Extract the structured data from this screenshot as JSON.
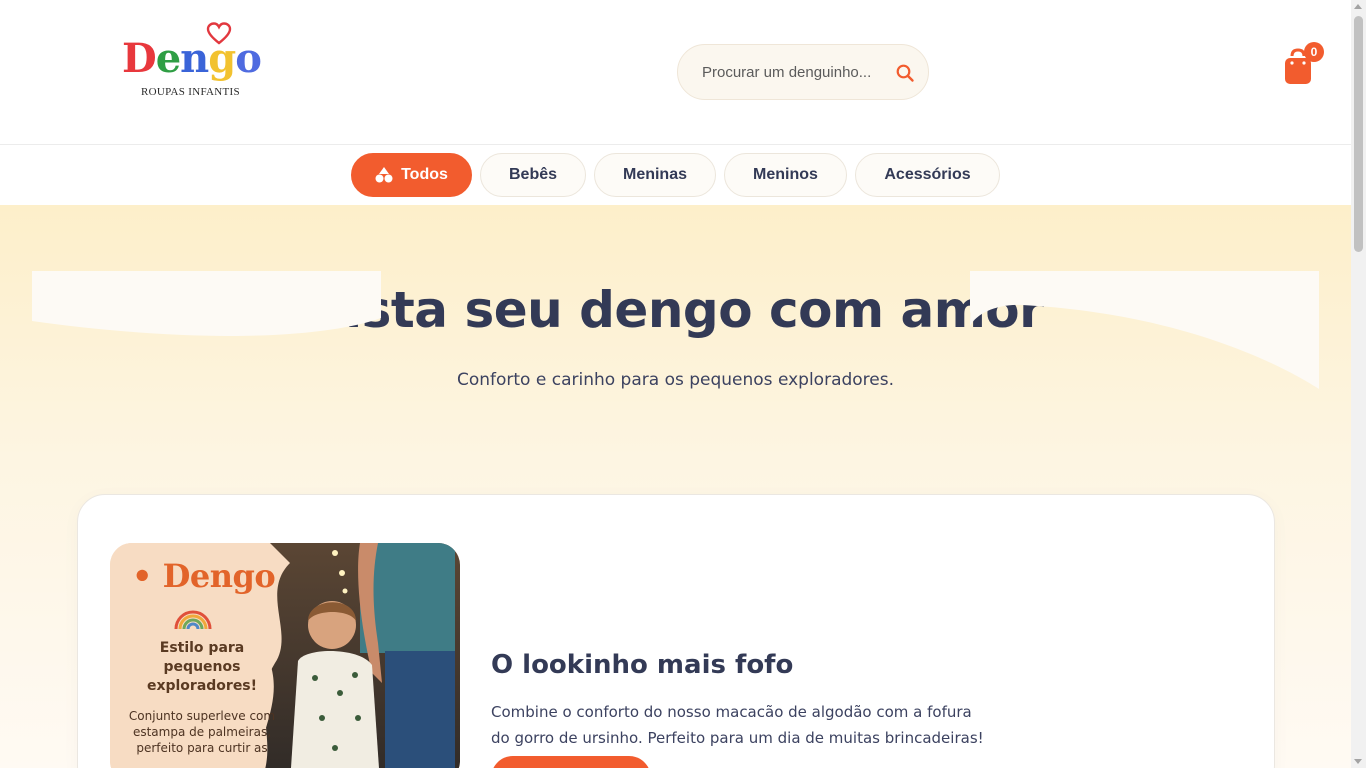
{
  "brand": {
    "name": "Dengo",
    "tagline": "ROUPAS INFANTIS",
    "letter_colors": [
      "#e8383d",
      "#2f9e44",
      "#3a64d8",
      "#f2c230",
      "#4f6be0"
    ]
  },
  "search": {
    "placeholder": "Procurar um denguinho...",
    "icon": "search-icon"
  },
  "cart": {
    "count": "0",
    "icon": "shopping-bag-icon"
  },
  "categories": [
    {
      "label": "Todos",
      "active": true,
      "icon": "shapes-icon"
    },
    {
      "label": "Bebês",
      "active": false
    },
    {
      "label": "Meninas",
      "active": false
    },
    {
      "label": "Meninos",
      "active": false
    },
    {
      "label": "Acessórios",
      "active": false
    }
  ],
  "hero": {
    "title": "Vista seu dengo com amor",
    "subtitle": "Conforto e carinho para os pequenos exploradores."
  },
  "product": {
    "promo": {
      "brand": "Dengo",
      "headline": "Estilo para pequenos exploradores!",
      "text": "Conjunto superleve com estampa de palmeiras, perfeito para curtir as"
    },
    "title": "O lookinho mais fofo",
    "description": "Combine o conforto do nosso macacão de algodão com a fofura do gorro de ursinho. Perfeito para um dia de muitas brincadeiras!"
  },
  "colors": {
    "accent": "#f25c2e",
    "text": "#333a56",
    "hero_bg": "#fdefca"
  }
}
